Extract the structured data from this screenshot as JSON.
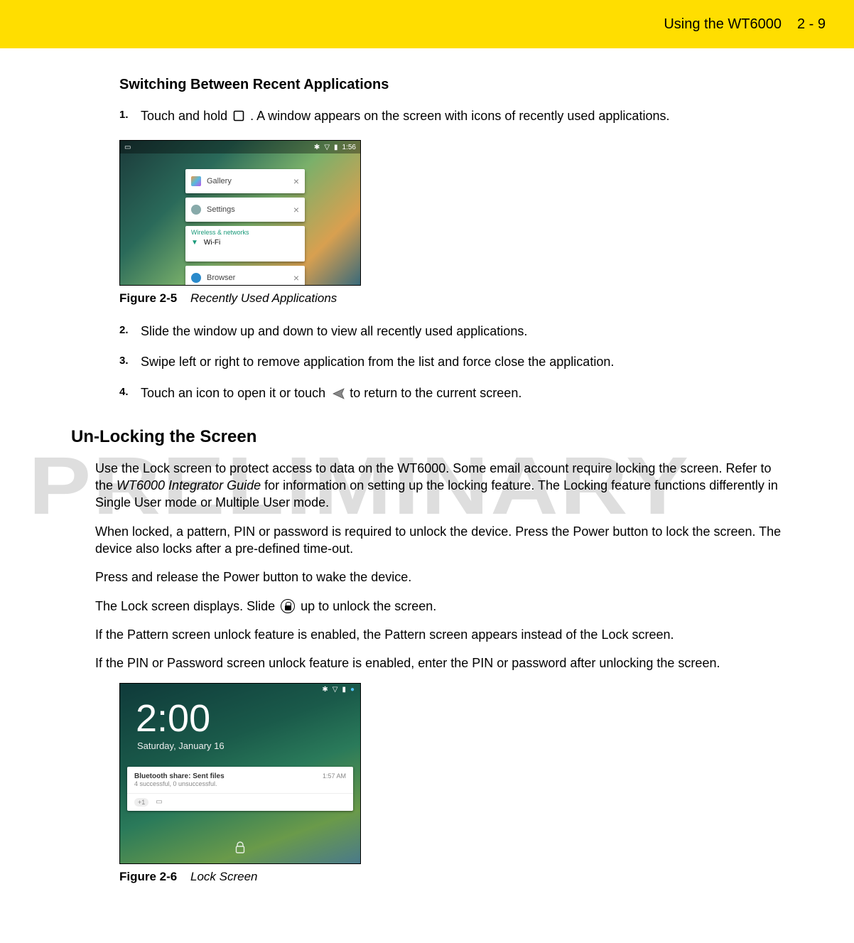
{
  "header": {
    "title": "Using the WT6000",
    "page": "2 - 9"
  },
  "watermark": "PRELIMINARY",
  "section1": {
    "title": "Switching Between Recent Applications",
    "steps": {
      "s1a": "Touch and hold ",
      "s1b": ". A window appears on the screen with icons of recently used applications.",
      "s2": "Slide the window up and down to view all recently used applications.",
      "s3": "Swipe left or right to remove application from the list and force close the application.",
      "s4a": "Touch an icon to open it or touch ",
      "s4b": " to return to the current screen."
    }
  },
  "figure25": {
    "num": "Figure 2-5",
    "title": "Recently Used Applications",
    "time": "1:56",
    "gallery": "Gallery",
    "settings": "Settings",
    "wifi_header": "Wireless & networks",
    "wifi": "Wi-Fi",
    "browser": "Browser"
  },
  "section2": {
    "title": "Un-Locking the Screen",
    "p1a": "Use the Lock screen to protect access to data on the WT6000. Some email account require locking the screen. Refer to the ",
    "p1em": "WT6000 Integrator Guide",
    "p1b": " for information on setting up the locking feature. The Locking feature functions differently in Single User mode or Multiple User mode.",
    "p2": "When locked, a pattern, PIN or password is required to unlock the device. Press the Power button to lock the screen. The device also locks after a pre-defined time-out.",
    "p3": "Press and release the Power button to wake the device.",
    "p4a": "The Lock screen displays. Slide ",
    "p4b": " up to unlock the screen.",
    "p5": "If the Pattern screen unlock feature is enabled, the Pattern screen appears instead of the Lock screen.",
    "p6": "If the PIN or Password screen unlock feature is enabled, enter the PIN or password after unlocking the screen."
  },
  "figure26": {
    "num": "Figure 2-6",
    "title": "Lock Screen",
    "time": "2:00",
    "date": "Saturday, January 16",
    "notif_title": "Bluetooth share: Sent files",
    "notif_sub": "4 successful, 0 unsuccessful.",
    "notif_time": "1:57 AM",
    "notif_badge": "+1"
  }
}
